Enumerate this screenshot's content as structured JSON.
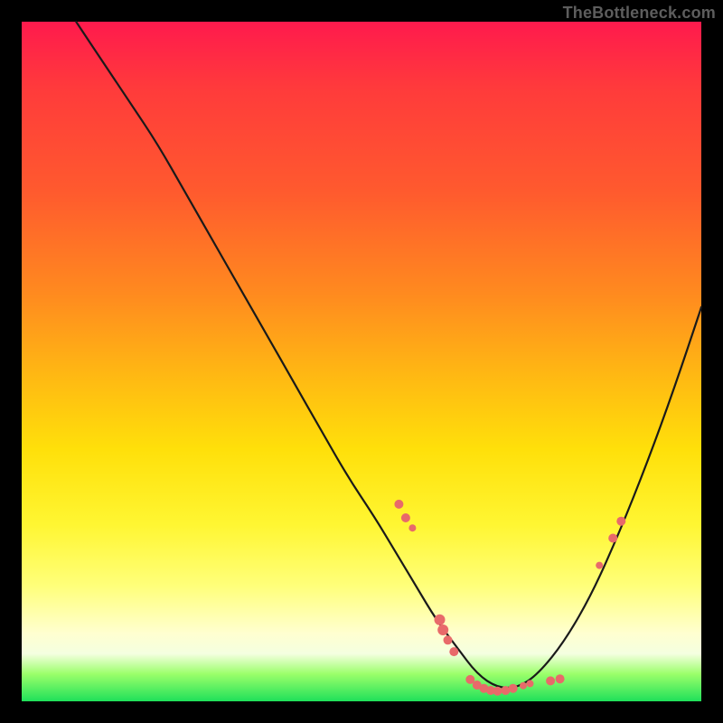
{
  "watermark": "TheBottleneck.com",
  "colors": {
    "marker_fill": "#e86a6a",
    "curve_stroke": "#1a1a1a"
  },
  "chart_data": {
    "type": "line",
    "title": "",
    "xlabel": "",
    "ylabel": "",
    "xlim": [
      0,
      100
    ],
    "ylim": [
      0,
      100
    ],
    "note": "No visible axis ticks or numeric labels; values are relative percentages of the plot area. Curve resembles a bottleneck/V shape: descending from top-left, reaching a minimum near x≈70, then rising toward the right edge.",
    "series": [
      {
        "name": "curve",
        "x": [
          8,
          12,
          16,
          20,
          24,
          28,
          32,
          36,
          40,
          44,
          48,
          52,
          55,
          58,
          61,
          64,
          67,
          70,
          73,
          76,
          80,
          84,
          88,
          92,
          96,
          100
        ],
        "y": [
          100,
          94,
          88,
          82,
          75,
          68,
          61,
          54,
          47,
          40,
          33,
          27,
          22,
          17,
          12,
          8,
          4,
          2,
          2,
          4,
          9,
          16,
          25,
          35,
          46,
          58
        ]
      }
    ],
    "markers": [
      {
        "x": 55.5,
        "y": 29,
        "r": 5
      },
      {
        "x": 56.5,
        "y": 27,
        "r": 5
      },
      {
        "x": 57.5,
        "y": 25.5,
        "r": 4
      },
      {
        "x": 61.5,
        "y": 12,
        "r": 6
      },
      {
        "x": 62.0,
        "y": 10.5,
        "r": 6
      },
      {
        "x": 62.7,
        "y": 9,
        "r": 5
      },
      {
        "x": 63.6,
        "y": 7.3,
        "r": 5
      },
      {
        "x": 66.0,
        "y": 3.2,
        "r": 5
      },
      {
        "x": 67.0,
        "y": 2.4,
        "r": 5
      },
      {
        "x": 68.0,
        "y": 1.9,
        "r": 5
      },
      {
        "x": 69.0,
        "y": 1.6,
        "r": 5
      },
      {
        "x": 70.0,
        "y": 1.5,
        "r": 5
      },
      {
        "x": 71.2,
        "y": 1.6,
        "r": 5
      },
      {
        "x": 72.3,
        "y": 1.9,
        "r": 5
      },
      {
        "x": 73.8,
        "y": 2.3,
        "r": 4
      },
      {
        "x": 74.8,
        "y": 2.6,
        "r": 4
      },
      {
        "x": 77.8,
        "y": 3.0,
        "r": 5
      },
      {
        "x": 79.2,
        "y": 3.3,
        "r": 5
      },
      {
        "x": 85.0,
        "y": 20,
        "r": 4
      },
      {
        "x": 87.0,
        "y": 24,
        "r": 5
      },
      {
        "x": 88.2,
        "y": 26.5,
        "r": 5
      }
    ]
  }
}
